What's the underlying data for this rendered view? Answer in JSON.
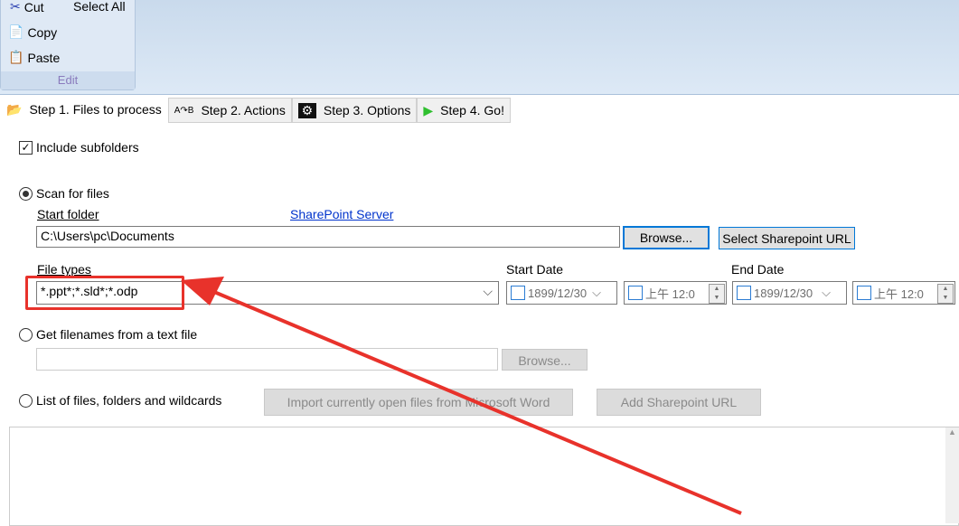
{
  "ribbon": {
    "cut": "Cut",
    "select_all": "Select All",
    "copy": "Copy",
    "paste": "Paste",
    "group_label": "Edit"
  },
  "tabs": [
    {
      "label": "Step 1. Files to process"
    },
    {
      "label": "Step 2. Actions"
    },
    {
      "label": "Step 3. Options"
    },
    {
      "label": "Step 4. Go!"
    }
  ],
  "form": {
    "include_subfolders": "Include subfolders",
    "scan_for_files": "Scan for files",
    "start_folder_label": "Start folder",
    "sharepoint_link": "SharePoint Server",
    "start_folder_value": "C:\\Users\\pc\\Documents",
    "browse": "Browse...",
    "select_sharepoint": "Select Sharepoint URL",
    "file_types_label": "File types",
    "file_types_value": "*.ppt*;*.sld*;*.odp",
    "start_date_label": "Start Date",
    "end_date_label": "End Date",
    "start_date": "1899/12/30",
    "start_time": "上午 12:0",
    "end_date": "1899/12/30",
    "end_time": "上午 12:0",
    "get_from_text": "Get filenames from a text file",
    "text_file_value": "",
    "browse2": "Browse...",
    "list_files": "List of files, folders and wildcards",
    "import_word": "Import currently open files from Microsoft Word",
    "add_sharepoint": "Add Sharepoint URL"
  }
}
